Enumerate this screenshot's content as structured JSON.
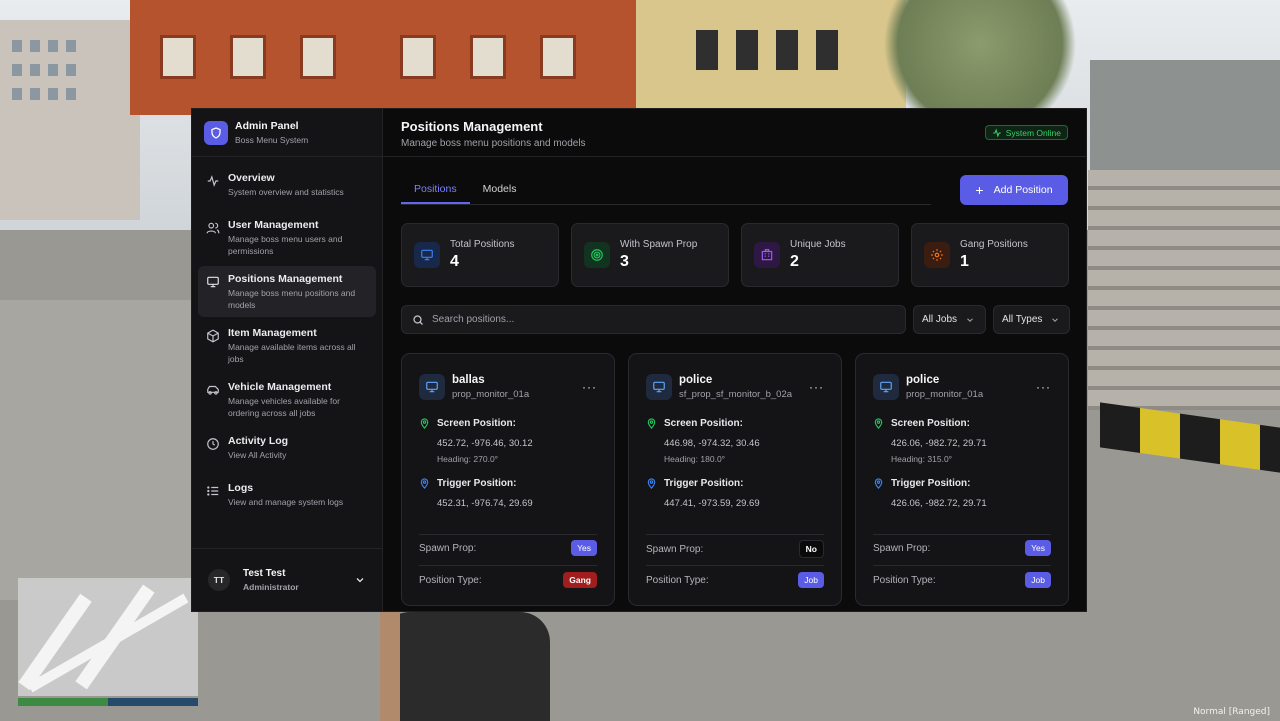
{
  "app": {
    "title": "Admin Panel",
    "subtitle": "Boss Menu System"
  },
  "sidebar": {
    "items": [
      {
        "title": "Overview",
        "desc": "System overview and statistics",
        "icon": "activity-icon"
      },
      {
        "title": "User Management",
        "desc": "Manage boss menu users and permissions",
        "icon": "users-icon"
      },
      {
        "title": "Positions Management",
        "desc": "Manage boss menu positions and models",
        "icon": "monitor-icon",
        "active": true
      },
      {
        "title": "Item Management",
        "desc": "Manage available items across all jobs",
        "icon": "box-icon"
      },
      {
        "title": "Vehicle Management",
        "desc": "Manage vehicles available for ordering across all jobs",
        "icon": "car-icon"
      },
      {
        "title": "Activity Log",
        "desc": "View All Activity",
        "icon": "clock-icon"
      },
      {
        "title": "Logs",
        "desc": "View and manage system logs",
        "icon": "list-icon"
      }
    ],
    "user": {
      "initials": "TT",
      "name": "Test Test",
      "role": "Administrator"
    }
  },
  "header": {
    "title": "Positions Management",
    "subtitle": "Manage boss menu positions and models",
    "status": "System Online"
  },
  "tabs": [
    {
      "label": "Positions",
      "active": true
    },
    {
      "label": "Models"
    }
  ],
  "add_button": "Add Position",
  "stats": [
    {
      "label": "Total Positions",
      "value": "4",
      "color": "#3b82f6"
    },
    {
      "label": "With Spawn Prop",
      "value": "3",
      "color": "#22c55e"
    },
    {
      "label": "Unique Jobs",
      "value": "2",
      "color": "#a855f7"
    },
    {
      "label": "Gang Positions",
      "value": "1",
      "color": "#f97316"
    }
  ],
  "search": {
    "placeholder": "Search positions..."
  },
  "filters": {
    "jobs": "All Jobs",
    "types": "All Types"
  },
  "labels": {
    "screen_position": "Screen Position:",
    "trigger_position": "Trigger Position:",
    "spawn_prop": "Spawn Prop:",
    "position_type": "Position Type:",
    "heading_prefix": "Heading:"
  },
  "cards": [
    {
      "name": "ballas",
      "model": "prop_monitor_01a",
      "screen": "452.72, -976.46, 30.12",
      "heading": "270.0°",
      "trigger": "452.31, -976.74, 29.69",
      "spawn_prop": "Yes",
      "type": "Gang"
    },
    {
      "name": "police",
      "model": "sf_prop_sf_monitor_b_02a",
      "screen": "446.98, -974.32, 30.46",
      "heading": "180.0°",
      "trigger": "447.41, -973.59, 29.69",
      "spawn_prop": "No",
      "type": "Job"
    },
    {
      "name": "police",
      "model": "prop_monitor_01a",
      "screen": "426.06, -982.72, 29.71",
      "heading": "315.0°",
      "trigger": "426.06, -982.72, 29.71",
      "spawn_prop": "Yes",
      "type": "Job"
    }
  ],
  "watermark": "Normal [Ranged]",
  "colors": {
    "accent": "#5b5ce6",
    "online": "#36d26a",
    "gang": "#a01e1e"
  }
}
